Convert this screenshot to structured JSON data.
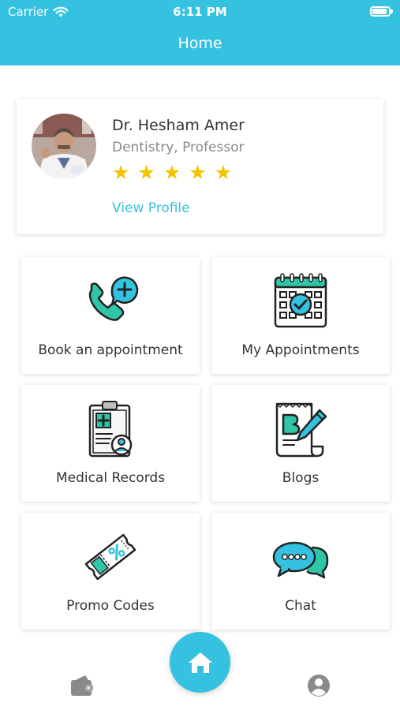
{
  "status_bar": {
    "carrier": "Carrier",
    "time": "6:11 PM",
    "battery_level": 0.9
  },
  "header": {
    "title": "Home"
  },
  "doctor": {
    "name": "Dr. Hesham Amer",
    "specialty": "Dentistry, Professor",
    "rating": 5,
    "rating_max": 5,
    "view_profile_label": "View Profile"
  },
  "tiles": [
    {
      "label": "Book an appointment",
      "icon": "phone-plus-icon"
    },
    {
      "label": "My Appointments",
      "icon": "calendar-check-icon"
    },
    {
      "label": "Medical Records",
      "icon": "clipboard-record-icon"
    },
    {
      "label": "Blogs",
      "icon": "blog-pen-icon"
    },
    {
      "label": "Promo Codes",
      "icon": "promo-ticket-icon"
    },
    {
      "label": "Chat",
      "icon": "chat-bubbles-icon"
    }
  ],
  "bottom_nav": {
    "left_icon": "wallet-icon",
    "center_icon": "home-icon",
    "right_icon": "profile-icon"
  },
  "colors": {
    "primary": "#35c2e0",
    "icon_teal": "#2fc6a7",
    "star": "#f5c400"
  }
}
